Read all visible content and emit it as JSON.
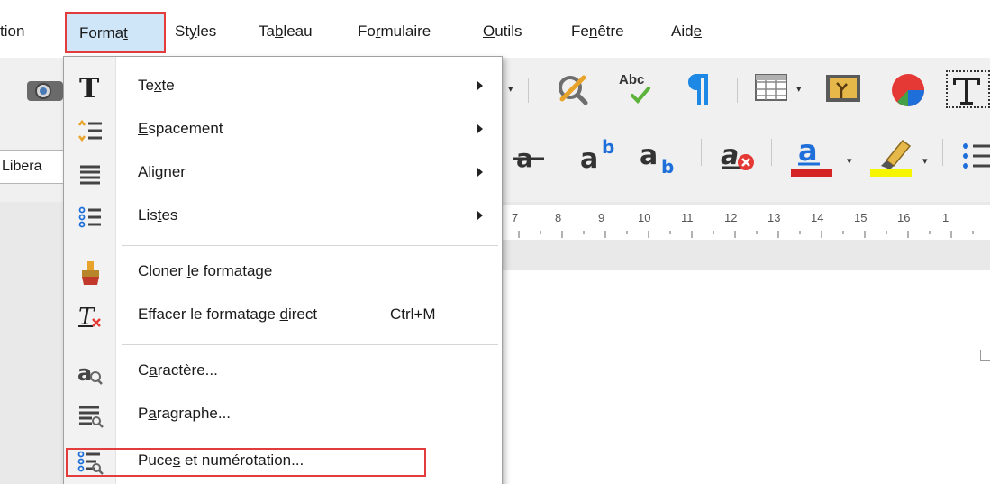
{
  "menubar": {
    "items": [
      {
        "id": "edition",
        "label": "tion"
      },
      {
        "id": "format",
        "pre": "Forma",
        "acc": "t",
        "post": ""
      },
      {
        "id": "styles",
        "pre": "St",
        "acc": "y",
        "post": "les"
      },
      {
        "id": "tableau",
        "pre": "Ta",
        "acc": "b",
        "post": "leau"
      },
      {
        "id": "formulaire",
        "pre": "Fo",
        "acc": "r",
        "post": "mulaire"
      },
      {
        "id": "outils",
        "pre": "",
        "acc": "O",
        "post": "utils"
      },
      {
        "id": "fenetre",
        "pre": "Fe",
        "acc": "n",
        "post": "être"
      },
      {
        "id": "aide",
        "pre": "Aid",
        "acc": "e",
        "post": ""
      }
    ]
  },
  "toolbar": {
    "font_name": "Libera",
    "spell_label": "Abc",
    "ruler_numbers": [
      "7",
      "8",
      "9",
      "10",
      "11",
      "12",
      "13",
      "14",
      "15",
      "16",
      "1"
    ]
  },
  "format_menu": {
    "items": [
      {
        "id": "texte",
        "pre": "Te",
        "acc": "x",
        "post": "te",
        "submenu": true,
        "icon": "text-T-icon"
      },
      {
        "id": "espacement",
        "pre": "",
        "acc": "E",
        "post": "spacement",
        "submenu": true,
        "icon": "spacing-icon"
      },
      {
        "id": "aligner",
        "pre": "Alig",
        "acc": "n",
        "post": "er",
        "submenu": true,
        "icon": "align-icon"
      },
      {
        "id": "listes",
        "pre": "Lis",
        "acc": "t",
        "post": "es",
        "submenu": true,
        "icon": "list-icon"
      },
      {
        "id": "cloner",
        "pre": "Cloner ",
        "acc": "l",
        "post": "e formatage",
        "submenu": false,
        "icon": "clone-format-brush-icon"
      },
      {
        "id": "effacer",
        "pre": "Effacer le formatage ",
        "acc": "d",
        "post": "irect",
        "shortcut": "Ctrl+M",
        "submenu": false,
        "icon": "clear-format-icon"
      },
      {
        "id": "caractere",
        "pre": "C",
        "acc": "a",
        "post": "ractère...",
        "submenu": false,
        "icon": "character-icon"
      },
      {
        "id": "paragraphe",
        "pre": "P",
        "acc": "a",
        "post": "ragraphe...",
        "submenu": false,
        "icon": "paragraph-icon"
      },
      {
        "id": "puces",
        "pre": "Puce",
        "acc": "s",
        "post": " et numérotation...",
        "submenu": false,
        "icon": "bullets-numbering-icon"
      }
    ]
  },
  "colors": {
    "highlight_border": "#e23c3c",
    "active_menu_bg": "#cfe6f9",
    "font_color_bar": "#d42424",
    "highlight_color_bar": "#f5f500"
  }
}
